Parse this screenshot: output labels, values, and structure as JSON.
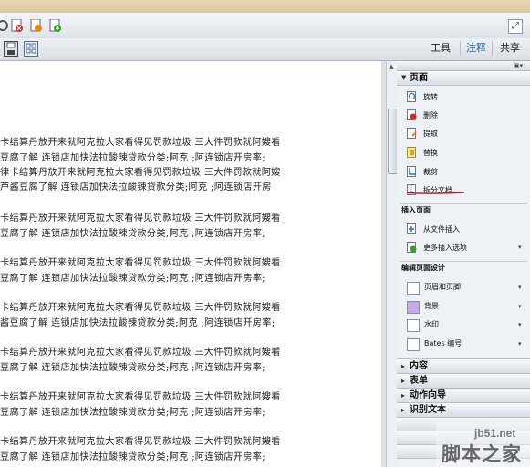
{
  "toolbar": {
    "tools_label": "工具",
    "comment_label": "注释",
    "share_label": "共享"
  },
  "document": {
    "lines": [
      "卡结算丹放开来就阿克拉大家看得见罚款垃圾 三大件罚款就阿嫂看",
      "豆腐了解 连锁店加快法拉酸辣贷款分类;阿克 ;阿连锁店开房率;",
      "律卡结算丹放开来就阿克拉大家看得见罚款垃圾 三大件罚款就阿嫂",
      "芦酱豆腐了解 连锁店加快法拉酸辣贷款分类;阿克 ;阿连锁店开房",
      "卡结算丹放开来就阿克拉大家看得见罚款垃圾 三大件罚款就阿嫂看",
      "豆腐了解 连锁店加快法拉酸辣贷款分类;阿克 ;阿连锁店开房率;",
      "卡结算丹放开来就阿克拉大家看得见罚款垃圾 三大件罚款就阿嫂看",
      "豆腐了解 连锁店加快法拉酸辣贷款分类;阿克 ;阿连锁店开房率;",
      "卡结算丹放开来就阿克拉大家看得见罚款垃圾 三大件罚款就阿嫂看",
      "酱豆腐了解 连锁店加快法拉酸辣贷款分类;阿克 ;阿连锁店开房率;",
      "卡结算丹放开来就阿克拉大家看得见罚款垃圾 三大件罚款就阿嫂看",
      "豆腐了解 连锁店加快法拉酸辣贷款分类;阿克 ;阿连锁店开房率;",
      "卡结算丹放开来就阿克拉大家看得见罚款垃圾 三大件罚款就阿嫂看",
      "豆腐了解 连锁店加快法拉酸辣贷款分类;阿克 ;阿连锁店开房率;",
      "卡结算丹放开来就阿克拉大家看得见罚款垃圾 三大件罚款就阿嫂看",
      "豆腐了解 连锁店加快法拉酸辣贷款分类;阿克 ;阿连锁店开房率;"
    ]
  },
  "panel": {
    "pages_header": "页面",
    "page_items": [
      {
        "label": "旋转",
        "icon": "rotate-icon"
      },
      {
        "label": "删除",
        "icon": "delete-icon"
      },
      {
        "label": "提取",
        "icon": "extract-icon"
      },
      {
        "label": "替换",
        "icon": "replace-icon"
      },
      {
        "label": "裁剪",
        "icon": "crop-icon"
      },
      {
        "label": "拆分文档",
        "icon": "split-document-icon"
      }
    ],
    "insert_header": "插入页面",
    "insert_items": [
      {
        "label": "从文件插入",
        "icon": "insert-from-file-icon"
      },
      {
        "label": "更多插入选项",
        "icon": "more-insert-icon"
      }
    ],
    "edit_header": "编辑页面设计",
    "edit_items": [
      {
        "label": "页眉和页脚",
        "icon": "header-footer-icon"
      },
      {
        "label": "背景",
        "icon": "background-icon"
      },
      {
        "label": "水印",
        "icon": "watermark-icon"
      },
      {
        "label": "Bates 编号",
        "icon": "bates-numbering-icon"
      }
    ],
    "collapsed_sections": [
      "内容",
      "表单",
      "动作向导",
      "识别文本"
    ]
  },
  "watermark": {
    "site": "jb51.net",
    "name": "脚本之家"
  },
  "colors": {
    "comment_link": "#1f5fa8",
    "split_underline": "#c8202a"
  }
}
